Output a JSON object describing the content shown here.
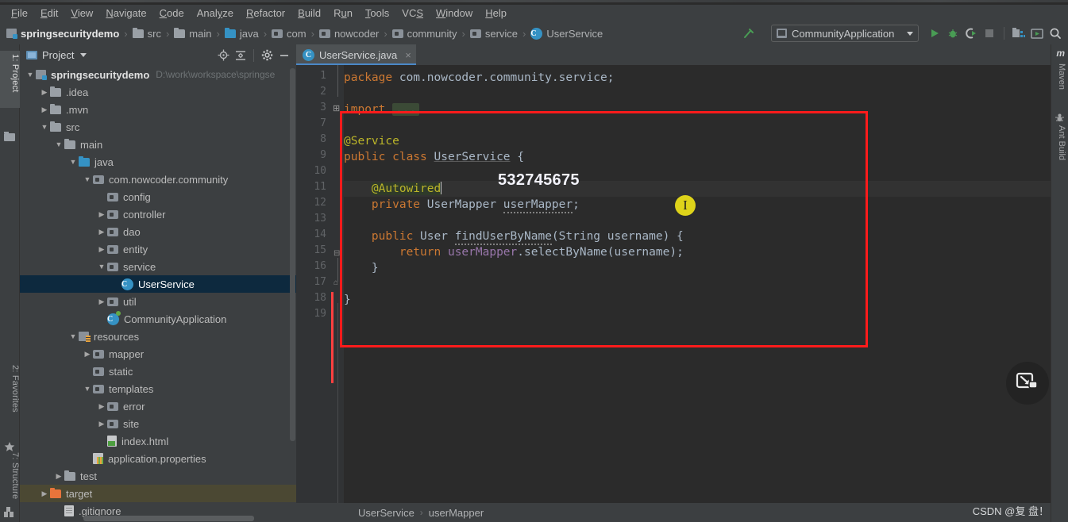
{
  "window": {
    "app": "IntelliJ IDEA",
    "project_name": "springsecuritydemo"
  },
  "menubar": {
    "items": [
      {
        "label": "File"
      },
      {
        "label": "Edit"
      },
      {
        "label": "View"
      },
      {
        "label": "Navigate"
      },
      {
        "label": "Code"
      },
      {
        "label": "Analyze"
      },
      {
        "label": "Refactor"
      },
      {
        "label": "Build"
      },
      {
        "label": "Run"
      },
      {
        "label": "Tools"
      },
      {
        "label": "VCS"
      },
      {
        "label": "Window"
      },
      {
        "label": "Help"
      }
    ]
  },
  "navbar": {
    "crumbs": [
      {
        "label": "springsecuritydemo",
        "icon": "module-icon"
      },
      {
        "label": "src",
        "icon": "folder-icon"
      },
      {
        "label": "main",
        "icon": "folder-icon"
      },
      {
        "label": "java",
        "icon": "source-folder-icon"
      },
      {
        "label": "com",
        "icon": "package-icon"
      },
      {
        "label": "nowcoder",
        "icon": "package-icon"
      },
      {
        "label": "community",
        "icon": "package-icon"
      },
      {
        "label": "service",
        "icon": "package-icon"
      },
      {
        "label": "UserService",
        "icon": "class-icon"
      }
    ],
    "separator": "›"
  },
  "toolbar": {
    "run_config": "CommunityApplication",
    "icons": [
      "hammer-build-icon",
      "run-icon",
      "debug-icon",
      "run-with-coverage-icon",
      "stop-icon",
      "project-structure-icon",
      "update-app-icon",
      "search-everywhere-icon"
    ]
  },
  "left_tool_strip": {
    "tabs": [
      {
        "label": "1: Project",
        "selected": true
      },
      {
        "label": "2: Favorites",
        "selected": false
      },
      {
        "label": "7: Structure",
        "selected": false
      }
    ]
  },
  "right_tool_strip": {
    "tabs": [
      {
        "label": "Maven"
      },
      {
        "label": "Ant Build"
      }
    ]
  },
  "project_panel": {
    "title": "Project",
    "header_icons": [
      "locate-icon",
      "collapse-all-icon",
      "settings-gear-icon",
      "hide-icon"
    ],
    "tree": [
      {
        "indent": 0,
        "arrow": "down",
        "icon": "module-icon",
        "label": "springsecuritydemo",
        "bold": true,
        "path": "D:\\work\\workspace\\springse"
      },
      {
        "indent": 1,
        "arrow": "right",
        "icon": "folder-icon",
        "label": ".idea"
      },
      {
        "indent": 1,
        "arrow": "right",
        "icon": "folder-icon",
        "label": ".mvn"
      },
      {
        "indent": 1,
        "arrow": "down",
        "icon": "folder-icon",
        "label": "src"
      },
      {
        "indent": 2,
        "arrow": "down",
        "icon": "folder-icon",
        "label": "main"
      },
      {
        "indent": 3,
        "arrow": "down",
        "icon": "source-folder-icon",
        "label": "java"
      },
      {
        "indent": 4,
        "arrow": "down",
        "icon": "package-icon",
        "label": "com.nowcoder.community"
      },
      {
        "indent": 5,
        "arrow": "none",
        "icon": "package-icon",
        "label": "config"
      },
      {
        "indent": 5,
        "arrow": "right",
        "icon": "package-icon",
        "label": "controller"
      },
      {
        "indent": 5,
        "arrow": "right",
        "icon": "package-icon",
        "label": "dao"
      },
      {
        "indent": 5,
        "arrow": "right",
        "icon": "package-icon",
        "label": "entity"
      },
      {
        "indent": 5,
        "arrow": "down",
        "icon": "package-icon",
        "label": "service"
      },
      {
        "indent": 6,
        "arrow": "none",
        "icon": "class-icon",
        "label": "UserService",
        "selected": true
      },
      {
        "indent": 5,
        "arrow": "right",
        "icon": "package-icon",
        "label": "util"
      },
      {
        "indent": 5,
        "arrow": "none",
        "icon": "spring-class-icon",
        "label": "CommunityApplication"
      },
      {
        "indent": 3,
        "arrow": "down",
        "icon": "resources-folder-icon",
        "label": "resources"
      },
      {
        "indent": 4,
        "arrow": "right",
        "icon": "package-icon",
        "label": "mapper"
      },
      {
        "indent": 4,
        "arrow": "none",
        "icon": "package-icon",
        "label": "static"
      },
      {
        "indent": 4,
        "arrow": "down",
        "icon": "package-icon",
        "label": "templates"
      },
      {
        "indent": 5,
        "arrow": "right",
        "icon": "package-icon",
        "label": "error"
      },
      {
        "indent": 5,
        "arrow": "right",
        "icon": "package-icon",
        "label": "site"
      },
      {
        "indent": 5,
        "arrow": "none",
        "icon": "html-file-icon",
        "label": "index.html"
      },
      {
        "indent": 4,
        "arrow": "none",
        "icon": "properties-file-icon",
        "label": "application.properties"
      },
      {
        "indent": 2,
        "arrow": "right",
        "icon": "folder-icon",
        "label": "test"
      },
      {
        "indent": 1,
        "arrow": "right",
        "icon": "target-folder-icon",
        "label": "target",
        "highlight": true
      },
      {
        "indent": 2,
        "arrow": "none",
        "icon": "file-icon",
        "label": ".gitignore"
      }
    ]
  },
  "editor": {
    "tab": {
      "label": "UserService.java",
      "icon": "class-icon",
      "close": "×"
    },
    "line_numbers": [
      "1",
      "2",
      "3",
      "7",
      "8",
      "9",
      "10",
      "11",
      "12",
      "13",
      "14",
      "15",
      "16",
      "17",
      "18",
      "19"
    ],
    "code_lines": [
      {
        "n": "1",
        "html": "<span class=\"k\">package</span> com.nowcoder.community.service;"
      },
      {
        "n": "2",
        "html": ""
      },
      {
        "n": "3",
        "html": "<span class=\"k\">import</span> <span class=\"import-fold\">...</span>"
      },
      {
        "n": "7",
        "html": ""
      },
      {
        "n": "8",
        "html": "<span class=\"ann\">@Service</span>"
      },
      {
        "n": "9",
        "html": "<span class=\"k\">public class</span> <span class=\"underl\">UserService</span> {"
      },
      {
        "n": "10",
        "html": ""
      },
      {
        "n": "11",
        "html": "    <span class=\"ann annhl\">@Autowired</span><span class=\"caret\"></span>"
      },
      {
        "n": "12",
        "html": "    <span class=\"k\">private</span> UserMapper <span class=\"squig\">userMapper</span>;"
      },
      {
        "n": "13",
        "html": ""
      },
      {
        "n": "14",
        "html": "    <span class=\"k\">public</span> User <span class=\"squig\">findUserByName</span>(String username) {"
      },
      {
        "n": "15",
        "html": "        <span class=\"k\">return</span> <span class=\"fld\">userMapper</span>.selectByName(username);"
      },
      {
        "n": "16",
        "html": "    }"
      },
      {
        "n": "17",
        "html": ""
      },
      {
        "n": "18",
        "html": "}"
      },
      {
        "n": "19",
        "html": ""
      }
    ],
    "plain_code": [
      "package com.nowcoder.community.service;",
      "",
      "import ...",
      "",
      "@Service",
      "public class UserService {",
      "",
      "    @Autowired",
      "    private UserMapper userMapper;",
      "",
      "    public User findUserByName(String username) {",
      "        return userMapper.selectByName(username);",
      "    }",
      "",
      "}",
      ""
    ]
  },
  "annotations": {
    "watermark_number": "532745675",
    "red_box": "highlight-rectangle",
    "cursor_icon": "text-ibeam-cursor",
    "snip_button": "screen-capture-icon"
  },
  "statusbar": {
    "breadcrumbs": [
      "UserService",
      "userMapper"
    ],
    "separator": "›",
    "watermark": "CSDN @复 盘！"
  },
  "colors": {
    "accent_blue": "#3592c4",
    "selection_blue": "#0d293e",
    "panel_bg": "#3c3f41",
    "editor_bg": "#2b2b2b",
    "annotation_red": "#ff1b1b",
    "keyword_orange": "#cc7832",
    "annotation_yellow": "#bbb529",
    "field_purple": "#9876aa",
    "run_green": "#499c54"
  }
}
